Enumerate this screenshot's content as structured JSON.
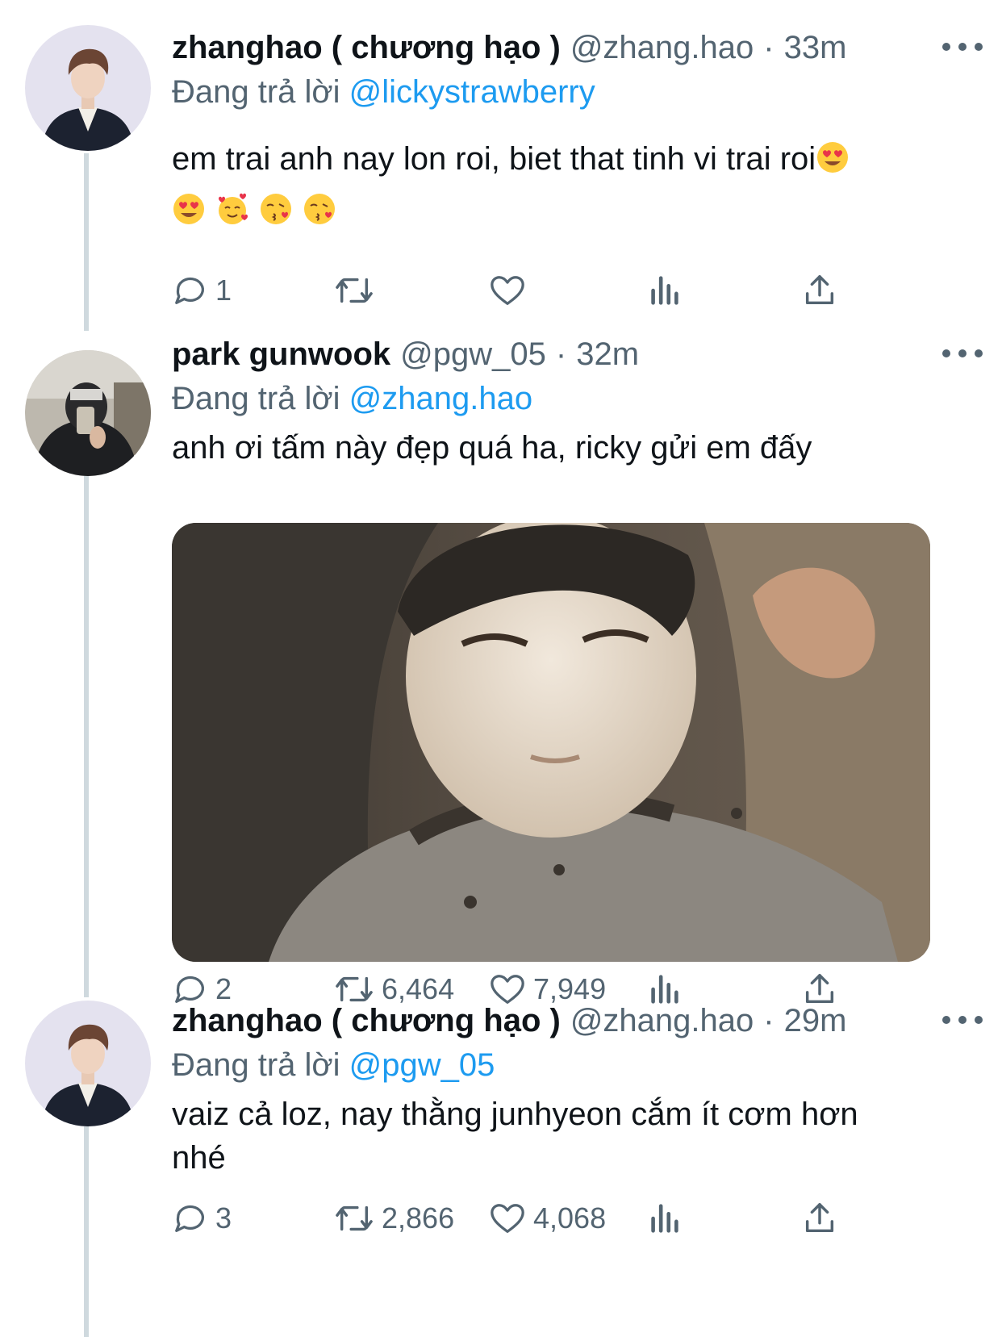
{
  "tweets": [
    {
      "name": "zhanghao ( chương hạo )",
      "handle": "@zhang.hao",
      "separator": "·",
      "time": "33m",
      "reply_prefix": "Đang trả lời",
      "reply_to": "@lickystrawberry",
      "text": "em trai anh nay lon roi, biet that tinh vi trai roi",
      "emojis": [
        "heart-eyes",
        "smiling-hearts",
        "kissing-heart",
        "kissing-heart"
      ],
      "replies": "1",
      "retweets": "",
      "likes": ""
    },
    {
      "name": "park gunwook",
      "handle": "@pgw_05",
      "separator": "·",
      "time": "32m",
      "reply_prefix": "Đang trả lời",
      "reply_to": "@zhang.hao",
      "text": "anh ơi tấm này đẹp quá ha, ricky gửi em đấy",
      "has_media": true,
      "replies": "2",
      "retweets": "6,464",
      "likes": "7,949"
    },
    {
      "name": "zhanghao ( chương hạo )",
      "handle": "@zhang.hao",
      "separator": "·",
      "time": "29m",
      "reply_prefix": "Đang trả lời",
      "reply_to": "@pgw_05",
      "text": "vaiz cả loz, nay thằng junhyeon cắm ít cơm hơn nhé",
      "replies": "3",
      "retweets": "2,866",
      "likes": "4,068"
    }
  ],
  "icons": {
    "reply": "reply-icon",
    "retweet": "retweet-icon",
    "like": "heart-icon",
    "views": "views-icon",
    "share": "share-icon",
    "more": "more-icon"
  },
  "colors": {
    "text": "#0f1419",
    "secondary": "#536471",
    "accent": "#1d9bf0",
    "thread_line": "#cfd9de"
  }
}
